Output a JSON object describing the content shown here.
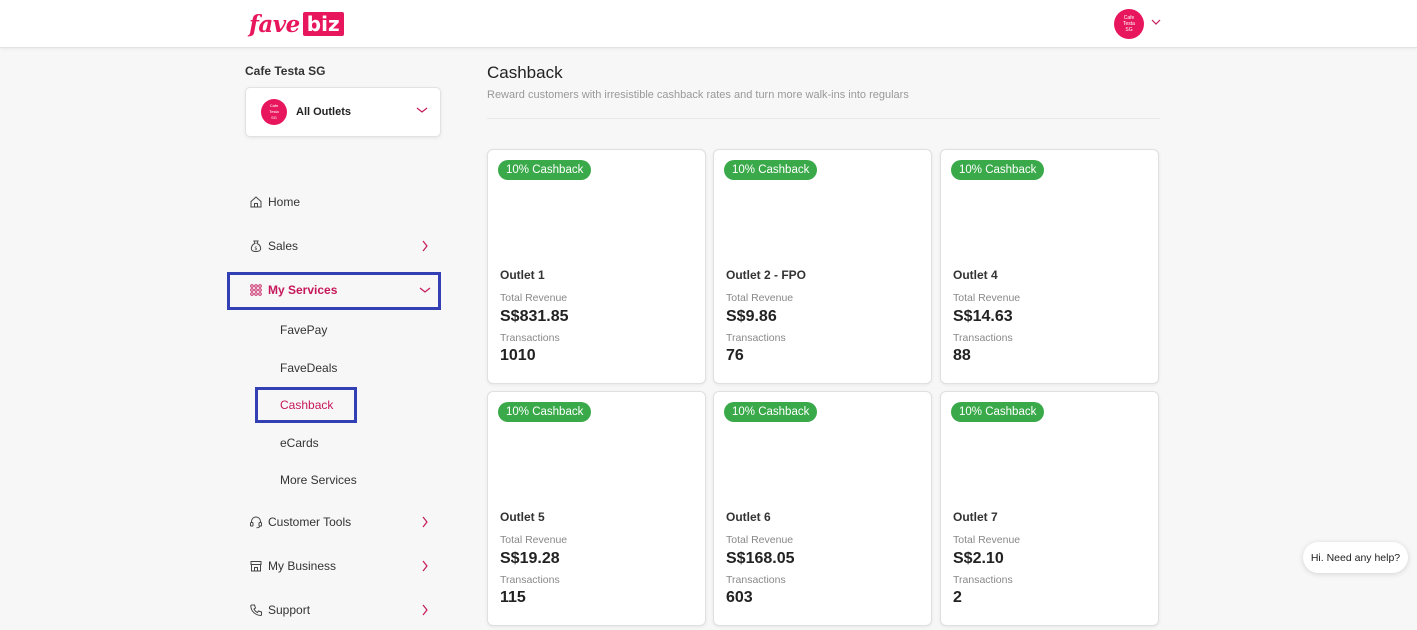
{
  "brand": {
    "name_part1": "fave",
    "name_part2": "biz",
    "color": "#e8175d"
  },
  "avatar": {
    "line1": "Cafe",
    "line2": "Testa",
    "line3": "SG"
  },
  "sidebar": {
    "store_name": "Cafe Testa SG",
    "outlet_select": "All Outlets",
    "items": [
      {
        "label": "Home",
        "icon": "home-icon"
      },
      {
        "label": "Sales",
        "icon": "money-bag-icon"
      },
      {
        "label": "My Services",
        "icon": "grid-icon"
      },
      {
        "label": "Customer Tools",
        "icon": "headset-icon"
      },
      {
        "label": "My Business",
        "icon": "store-icon"
      },
      {
        "label": "Support",
        "icon": "phone-icon"
      }
    ],
    "sub_items": [
      "FavePay",
      "FaveDeals",
      "Cashback",
      "eCards",
      "More Services"
    ]
  },
  "main": {
    "title": "Cashback",
    "subtitle": "Reward customers with irresistible cashback rates and turn more walk-ins into regulars",
    "revenue_label": "Total Revenue",
    "transactions_label": "Transactions",
    "cards": [
      {
        "badge": "10% Cashback",
        "name": "Outlet 1",
        "revenue": "S$831.85",
        "transactions": "1010"
      },
      {
        "badge": "10% Cashback",
        "name": "Outlet 2 - FPO",
        "revenue": "S$9.86",
        "transactions": "76"
      },
      {
        "badge": "10% Cashback",
        "name": "Outlet 4",
        "revenue": "S$14.63",
        "transactions": "88"
      },
      {
        "badge": "10% Cashback",
        "name": "Outlet 5",
        "revenue": "S$19.28",
        "transactions": "115"
      },
      {
        "badge": "10% Cashback",
        "name": "Outlet 6",
        "revenue": "S$168.05",
        "transactions": "603"
      },
      {
        "badge": "10% Cashback",
        "name": "Outlet 7",
        "revenue": "S$2.10",
        "transactions": "2"
      }
    ]
  },
  "help": {
    "label": "Hi. Need any help?"
  },
  "colors": {
    "accent": "#c6185b",
    "badge": "#3aa94a",
    "highlight": "#3340b3"
  }
}
